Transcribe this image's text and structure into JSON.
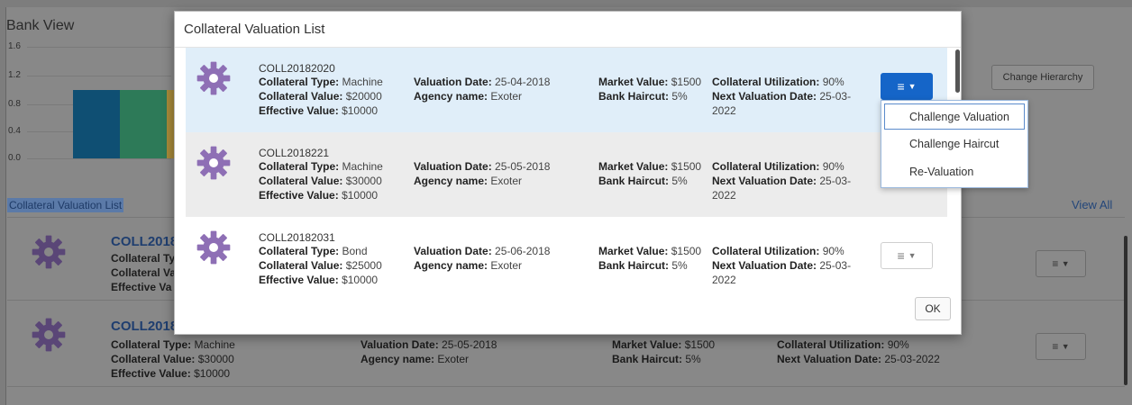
{
  "background": {
    "title": "Bank View",
    "y_ticks": [
      "1.6",
      "1.2",
      "0.8",
      "0.4",
      "0.0"
    ],
    "change_hierarchy_label": "Change Hierarchy",
    "section_title": "Collateral Valuation List",
    "view_all_label": "View All",
    "bar_colors": [
      "#0f4f73",
      "#2d7a58",
      "#a98b3a"
    ],
    "rows": [
      {
        "id": "COLL2018",
        "type_label": "Collateral Ty",
        "value_label": "Collateral Va",
        "effective_label": "Effective Va"
      },
      {
        "id": "COLL2018",
        "type_label": "Collateral Type:",
        "type_value": "Machine",
        "value_label": "Collateral Value:",
        "value_value": "$30000",
        "effective_label": "Effective Value:",
        "effective_value": "$10000",
        "valuation_date_label": "Valuation Date:",
        "valuation_date": "25-05-2018",
        "agency_label": "Agency name:",
        "agency": "Exoter",
        "market_label": "Market Value:",
        "market": "$1500",
        "haircut_label": "Bank Haircut:",
        "haircut": "5%",
        "utilization_label": "Collateral Utilization:",
        "utilization": "90%",
        "next_label": "Next Valuation Date:",
        "next": "25-03-2022"
      }
    ]
  },
  "modal": {
    "title": "Collateral Valuation List",
    "ok_label": "OK",
    "labels": {
      "type": "Collateral Type:",
      "value": "Collateral Value:",
      "effective": "Effective Value:",
      "valuation_date": "Valuation Date:",
      "agency": "Agency name:",
      "market": "Market Value:",
      "haircut": "Bank Haircut:",
      "utilization": "Collateral Utilization:",
      "next": "Next Valuation Date:"
    },
    "items": [
      {
        "id": "COLL20182020",
        "type": "Machine",
        "value": "$20000",
        "effective": "$10000",
        "valuation_date": "25-04-2018",
        "agency": "Exoter",
        "market": "$1500",
        "haircut": "5%",
        "utilization": "90%",
        "next_line1": "25-03-",
        "next_line2": "2022"
      },
      {
        "id": "COLL2018221",
        "type": "Machine",
        "value": "$30000",
        "effective": "$10000",
        "valuation_date": "25-05-2018",
        "agency": "Exoter",
        "market": "$1500",
        "haircut": "5%",
        "utilization": "90%",
        "next_line1": "25-03-",
        "next_line2": "2022"
      },
      {
        "id": "COLL20182031",
        "type": "Bond",
        "value": "$25000",
        "effective": "$10000",
        "valuation_date": "25-06-2018",
        "agency": "Exoter",
        "market": "$1500",
        "haircut": "5%",
        "utilization": "90%",
        "next_line1": "25-03-",
        "next_line2": "2022"
      }
    ],
    "dropdown": [
      "Challenge Valuation",
      "Challenge Haircut",
      "Re-Valuation"
    ]
  },
  "colors": {
    "accent": "#1565c8",
    "selected_row": "#e0eef9",
    "gear": "#8e6fb5"
  }
}
